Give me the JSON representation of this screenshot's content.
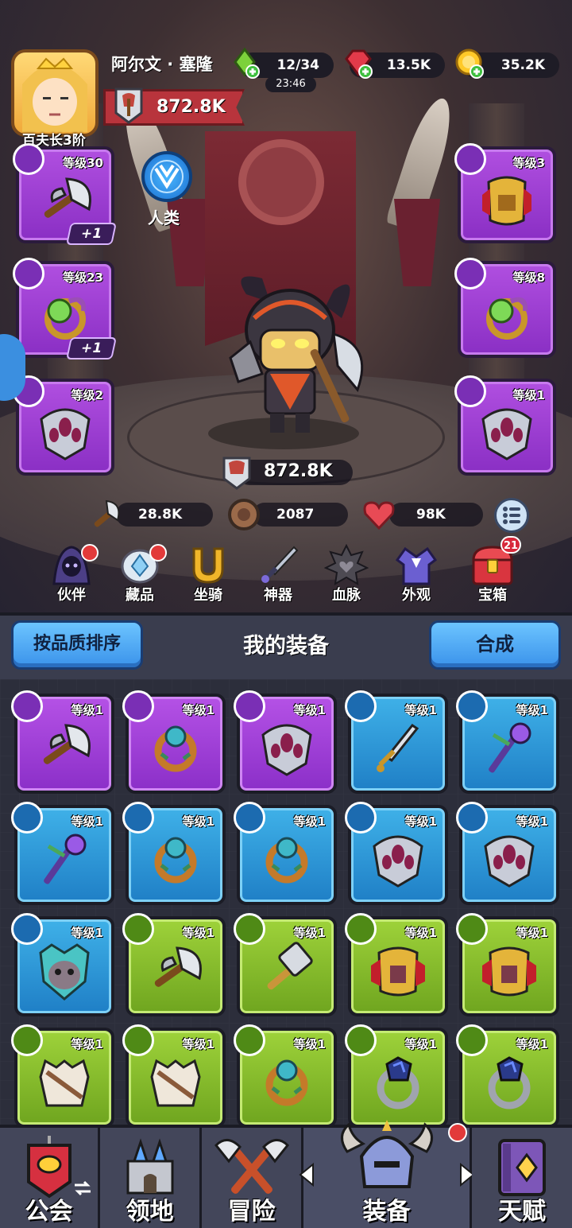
{
  "header": {
    "player_name": "阿尔文 · 塞隆",
    "rank": "百夫长3阶",
    "energy": "12/34",
    "energy_timer": "23:46",
    "gems": "13.5K",
    "gold": "35.2K",
    "power": "872.8K"
  },
  "scene": {
    "race_label": "人类",
    "left_slots": [
      {
        "level": "等级30",
        "plus": "+1",
        "kind": "axe"
      },
      {
        "level": "等级23",
        "plus": "+1",
        "kind": "ring"
      },
      {
        "level": "等级2",
        "kind": "helmet"
      }
    ],
    "right_slots": [
      {
        "level": "等级3",
        "kind": "armor"
      },
      {
        "level": "等级8",
        "kind": "ring"
      },
      {
        "level": "等级1",
        "kind": "helmet"
      }
    ],
    "total_power": "872.8K",
    "attack": "28.8K",
    "defense": "2087",
    "hp": "98K"
  },
  "features": [
    {
      "label": "伙伴",
      "icon": "hooded-companion-icon",
      "dot": true
    },
    {
      "label": "藏品",
      "icon": "crystal-collection-icon",
      "dot": true
    },
    {
      "label": "坐骑",
      "icon": "mount-horseshoe-icon",
      "dot": false
    },
    {
      "label": "神器",
      "icon": "artifact-sword-icon",
      "dot": false
    },
    {
      "label": "血脉",
      "icon": "bloodline-icon",
      "dot": false
    },
    {
      "label": "外观",
      "icon": "outfit-icon",
      "dot": false
    },
    {
      "label": "宝箱",
      "icon": "treasure-chest-icon",
      "count": "21"
    }
  ],
  "inventory": {
    "sort_label": "按品质排序",
    "title": "我的装备",
    "merge_label": "合成",
    "items": [
      {
        "level": "等级1",
        "rarity": "purple",
        "kind": "axe"
      },
      {
        "level": "等级1",
        "rarity": "purple",
        "kind": "ring"
      },
      {
        "level": "等级1",
        "rarity": "purple",
        "kind": "helmet"
      },
      {
        "level": "等级1",
        "rarity": "blue",
        "kind": "sword"
      },
      {
        "level": "等级1",
        "rarity": "blue",
        "kind": "staff"
      },
      {
        "level": "等级1",
        "rarity": "blue",
        "kind": "staff"
      },
      {
        "level": "等级1",
        "rarity": "blue",
        "kind": "ring"
      },
      {
        "level": "等级1",
        "rarity": "blue",
        "kind": "ring"
      },
      {
        "level": "等级1",
        "rarity": "blue",
        "kind": "helmet"
      },
      {
        "level": "等级1",
        "rarity": "blue",
        "kind": "helmet"
      },
      {
        "level": "等级1",
        "rarity": "blue",
        "kind": "mask"
      },
      {
        "level": "等级1",
        "rarity": "green",
        "kind": "axe"
      },
      {
        "level": "等级1",
        "rarity": "green",
        "kind": "hammer"
      },
      {
        "level": "等级1",
        "rarity": "green",
        "kind": "armor"
      },
      {
        "level": "等级1",
        "rarity": "green",
        "kind": "armor"
      },
      {
        "level": "等级1",
        "rarity": "green",
        "kind": "vest"
      },
      {
        "level": "等级1",
        "rarity": "green",
        "kind": "vest"
      },
      {
        "level": "等级1",
        "rarity": "green",
        "kind": "ring"
      },
      {
        "level": "等级1",
        "rarity": "green",
        "kind": "darkring"
      },
      {
        "level": "等级1",
        "rarity": "green",
        "kind": "darkring"
      }
    ]
  },
  "nav": {
    "guild": "公会",
    "territory": "领地",
    "adventure": "冒险",
    "equipment": "装备",
    "talent": "天赋"
  },
  "colors": {
    "purple": "#9a3fd6",
    "blue": "#2c93d8",
    "green": "#84bb2a",
    "accent_blue": "#4aa8f5",
    "power_red": "#b8343c"
  }
}
